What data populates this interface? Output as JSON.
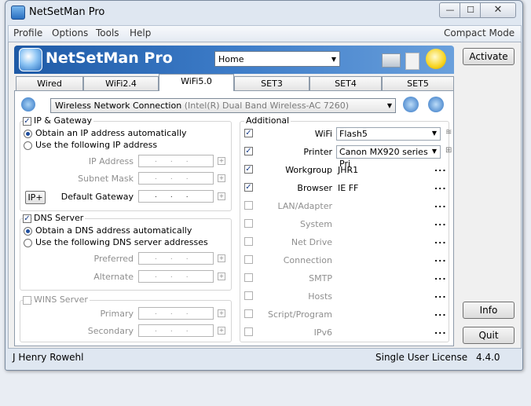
{
  "window": {
    "title": "NetSetMan Pro"
  },
  "menu": {
    "items": [
      "Profile",
      "Options",
      "Tools",
      "Help"
    ],
    "compact_mode": "Compact Mode"
  },
  "banner": {
    "app_name": "NetSetMan Pro",
    "profile": "Home"
  },
  "buttons": {
    "activate": "Activate",
    "info": "Info",
    "quit": "Quit",
    "ip_plus": "IP+"
  },
  "tabs": [
    {
      "label": "Wired"
    },
    {
      "label": "WiFi2.4"
    },
    {
      "label": "WiFi5.0"
    },
    {
      "label": "SET3"
    },
    {
      "label": "SET4"
    },
    {
      "label": "SET5"
    }
  ],
  "active_tab": "WiFi5.0",
  "adapter": {
    "name": "Wireless Network Connection",
    "detail": "(Intel(R) Dual Band Wireless-AC 7260)"
  },
  "ip_gateway": {
    "title": "IP & Gateway",
    "option_auto": "Obtain an IP address automatically",
    "option_manual": "Use the following IP address",
    "fields": {
      "ip_address": "IP Address",
      "subnet_mask": "Subnet Mask",
      "default_gateway": "Default Gateway"
    },
    "ip_placeholder": "..."
  },
  "dns": {
    "title": "DNS Server",
    "option_auto": "Obtain a DNS address automatically",
    "option_manual": "Use the following DNS server addresses",
    "fields": {
      "preferred": "Preferred",
      "alternate": "Alternate"
    }
  },
  "wins": {
    "title": "WINS Server",
    "fields": {
      "primary": "Primary",
      "secondary": "Secondary"
    }
  },
  "additional": {
    "title": "Additional",
    "rows": [
      {
        "label": "WiFi",
        "value": "Flash5"
      },
      {
        "label": "Printer",
        "value": "Canon MX920 series Pri"
      },
      {
        "label": "Workgroup",
        "value": "JHR1"
      },
      {
        "label": "Browser",
        "value": "IE FF"
      },
      {
        "label": "LAN/Adapter",
        "value": ""
      },
      {
        "label": "System",
        "value": ""
      },
      {
        "label": "Net Drive",
        "value": ""
      },
      {
        "label": "Connection",
        "value": ""
      },
      {
        "label": "SMTP",
        "value": ""
      },
      {
        "label": "Hosts",
        "value": ""
      },
      {
        "label": "Script/Program",
        "value": ""
      },
      {
        "label": "IPv6",
        "value": ""
      }
    ],
    "more": "..."
  },
  "status": {
    "user": "J Henry Rowehl",
    "license": "Single User License",
    "version": "4.4.0"
  },
  "window_controls": {
    "minimize": "—",
    "maximize": "☐",
    "close": "✕"
  }
}
